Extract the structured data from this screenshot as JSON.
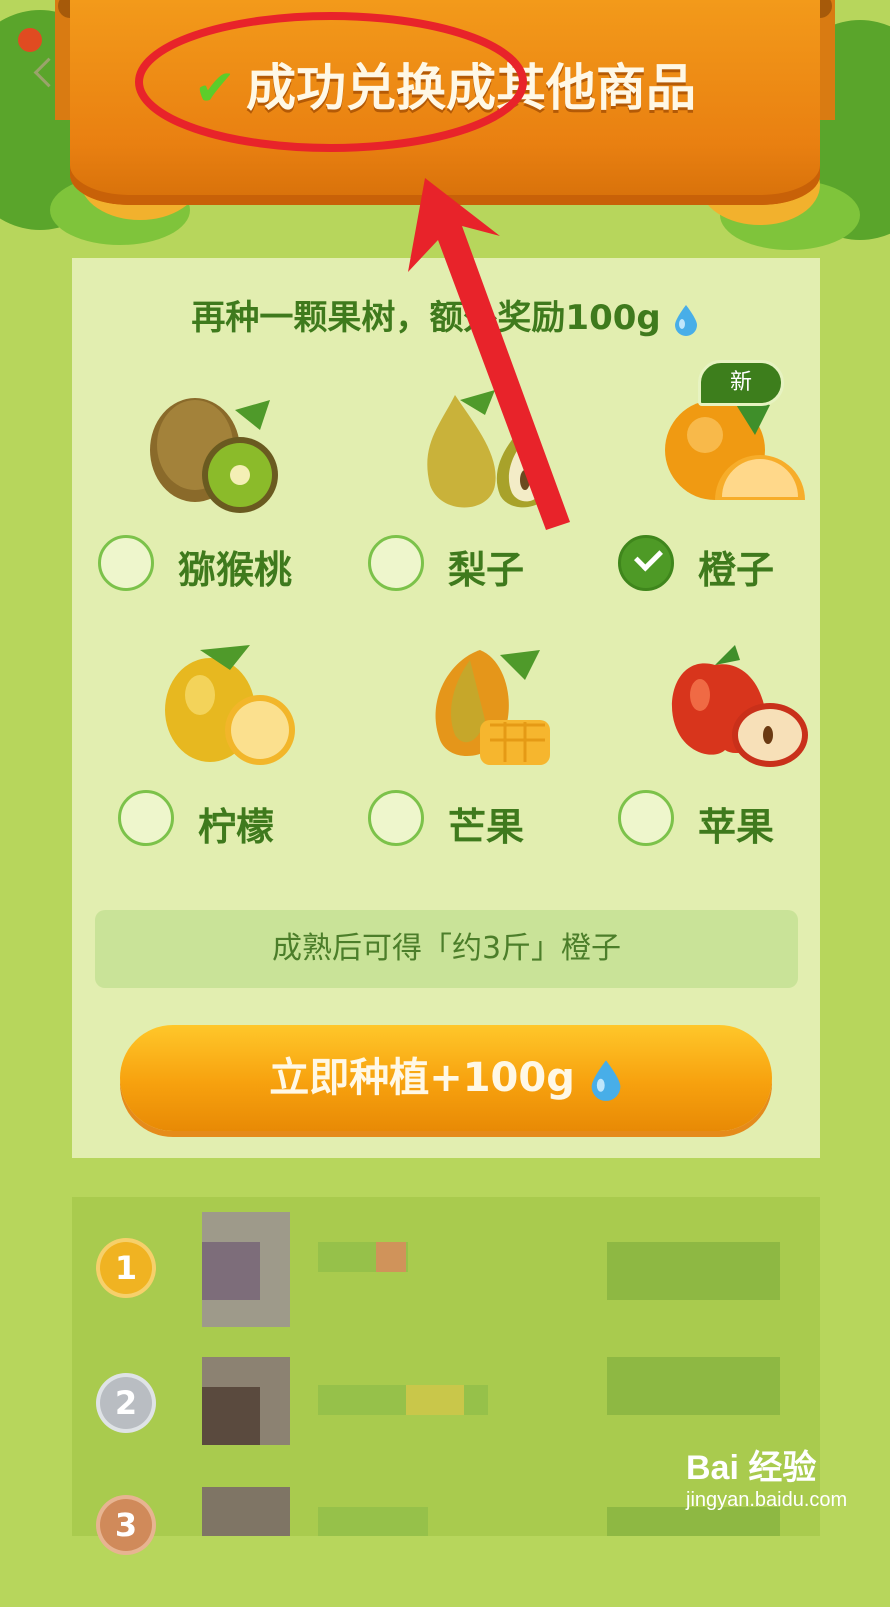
{
  "banner": {
    "title": "成功兑换成其他商品"
  },
  "card": {
    "subtitle": "再种一颗果树，额外奖励100g",
    "new_badge": "新",
    "fruits": [
      {
        "name": "猕猴桃",
        "selected": false
      },
      {
        "name": "梨子",
        "selected": false
      },
      {
        "name": "橙子",
        "selected": true
      },
      {
        "name": "柠檬",
        "selected": false
      },
      {
        "name": "芒果",
        "selected": false
      },
      {
        "name": "苹果",
        "selected": false
      }
    ],
    "yield_text": "成熟后可得「约3斤」橙子",
    "plant_button": "立即种植+100g"
  },
  "ranking": {
    "medals": [
      "1",
      "2",
      "3"
    ]
  },
  "watermark": {
    "logo": "Bai 经验",
    "site": "jingyan.baidu.com"
  },
  "colors": {
    "accent_green": "#3f7a1d",
    "button_orange": "#f7a10e",
    "annotation_red": "#e8232a"
  }
}
